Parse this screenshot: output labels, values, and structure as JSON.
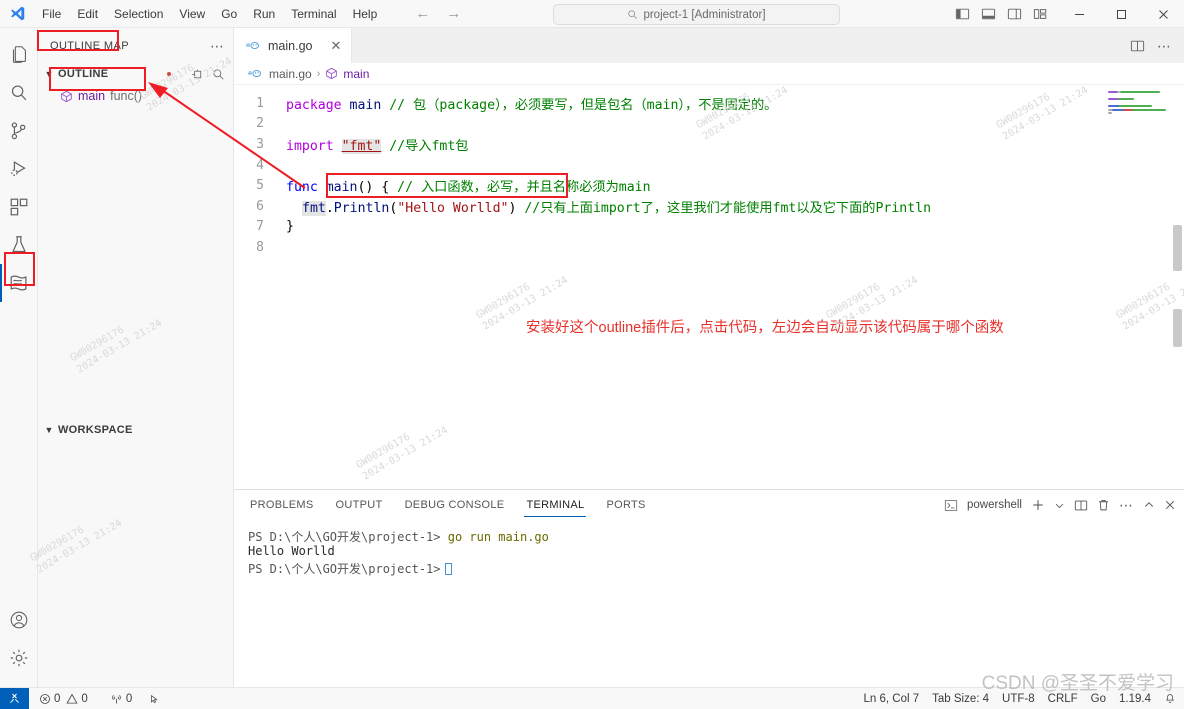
{
  "titlebar": {
    "menus": [
      "File",
      "Edit",
      "Selection",
      "View",
      "Go",
      "Run",
      "Terminal",
      "Help"
    ],
    "back_arrow": "←",
    "forward_arrow": "→",
    "search_placeholder": "project-1 [Administrator]",
    "layout_icons": [
      "toggle-primary-sidebar",
      "toggle-panel",
      "toggle-secondary-sidebar",
      "customize-layout"
    ],
    "window_controls": {
      "minimize": "─",
      "maximize": "□",
      "close": "✕"
    }
  },
  "activitybar": {
    "items": [
      {
        "name": "explorer",
        "label": "Explorer"
      },
      {
        "name": "search",
        "label": "Search"
      },
      {
        "name": "source-control",
        "label": "Source Control"
      },
      {
        "name": "run-and-debug",
        "label": "Run and Debug"
      },
      {
        "name": "extensions",
        "label": "Extensions"
      },
      {
        "name": "testing",
        "label": "Testing"
      },
      {
        "name": "outline-map",
        "label": "Outline Map"
      }
    ],
    "bottom_items": [
      {
        "name": "accounts",
        "label": "Accounts"
      },
      {
        "name": "manage",
        "label": "Manage"
      }
    ],
    "active_index": 6
  },
  "sidebar": {
    "title": "OUTLINE MAP",
    "more_actions": "⋯",
    "sections": [
      {
        "label": "OUTLINE",
        "expanded": true,
        "items": [
          {
            "icon": "class-symbol-icon",
            "name": "main",
            "kind": "func()"
          }
        ]
      },
      {
        "label": "WORKSPACE",
        "expanded": true,
        "items": []
      }
    ]
  },
  "editor": {
    "tab": {
      "label": "main.go",
      "icon": "go-file-icon",
      "close": "✕"
    },
    "tab_actions": [
      "split-editor",
      "more-actions"
    ],
    "breadcrumb": {
      "file": "main.go",
      "separator": "›",
      "symbol": "main"
    },
    "lines": [
      {
        "num": 1,
        "tokens": [
          {
            "t": "package ",
            "c": "kw2"
          },
          {
            "t": "main",
            "c": "fn"
          },
          {
            "t": " // 包（package），必须要写，但是包名（main），不是固定的。",
            "c": "cmt"
          }
        ]
      },
      {
        "num": 2,
        "tokens": []
      },
      {
        "num": 3,
        "tokens": [
          {
            "t": "import ",
            "c": "kw2"
          },
          {
            "t": "\"fmt\"",
            "c": "str hl underl"
          },
          {
            "t": " //导入fmt包",
            "c": "cmt"
          }
        ]
      },
      {
        "num": 4,
        "tokens": []
      },
      {
        "num": 5,
        "tokens": [
          {
            "t": "func ",
            "c": "kw"
          },
          {
            "t": "main",
            "c": "fn"
          },
          {
            "t": "() { ",
            "c": "ctext"
          },
          {
            "t": "// 入口函数，必写，并且名称必须为main",
            "c": "cmt"
          }
        ]
      },
      {
        "num": 6,
        "indent": true,
        "tokens": [
          {
            "t": "fmt",
            "c": "fn hl"
          },
          {
            "t": ".",
            "c": "ctext"
          },
          {
            "t": "Println",
            "c": "fn"
          },
          {
            "t": "(",
            "c": "ctext"
          },
          {
            "t": "\"Hello Worlld\"",
            "c": "str"
          },
          {
            "t": ")",
            "c": "ctext"
          },
          {
            "t": " //只有上面import了，这里我们才能使用fmt以及它下面的Println",
            "c": "cmt"
          }
        ]
      },
      {
        "num": 7,
        "tokens": [
          {
            "t": "}",
            "c": "ctext"
          }
        ]
      },
      {
        "num": 8,
        "tokens": []
      }
    ],
    "annotation": "安装好这个outline插件后，点击代码，左边会自动显示该代码属于哪个函数"
  },
  "panel": {
    "tabs": [
      "PROBLEMS",
      "OUTPUT",
      "DEBUG CONSOLE",
      "TERMINAL",
      "PORTS"
    ],
    "active_tab": "TERMINAL",
    "shell_name": "powershell",
    "actions": [
      "new-terminal",
      "terminal-dropdown",
      "split-terminal",
      "kill-terminal",
      "more-actions",
      "maximize-panel",
      "close-panel"
    ],
    "terminal_lines": [
      {
        "prompt": "PS D:\\个人\\GO开发\\project-1>",
        "command": " go run main.go"
      },
      {
        "prompt": "",
        "command": "Hello Worlld",
        "plain": true
      },
      {
        "prompt": "PS D:\\个人\\GO开发\\project-1>",
        "command": "",
        "cursor": true
      }
    ]
  },
  "statusbar": {
    "remote_icon": "remote-indicator-icon",
    "left": [
      {
        "name": "errors",
        "icon": "error-icon",
        "value": "0"
      },
      {
        "name": "warnings",
        "icon": "warning-icon",
        "value": "0"
      },
      {
        "name": "ports",
        "icon": "radio-tower-icon",
        "value": "0"
      },
      {
        "name": "go-build",
        "icon": "go-pointer-icon",
        "value": ""
      }
    ],
    "right": [
      "Ln 6, Col 7",
      "Tab Size: 4",
      "UTF-8",
      "CRLF",
      "Go",
      "1.19.4"
    ],
    "bell_icon": "bell-icon"
  },
  "watermarks": {
    "csdn": "CSDN @圣圣不爱学习",
    "tiled": "GW00296176\n2024-03-13 21:24"
  },
  "colors": {
    "accent": "#005fb8",
    "annotation_red": "#ee1c25",
    "keyword": "#0000ff",
    "keyword_alt": "#af00db",
    "string": "#a31515",
    "comment": "#008000",
    "function": "#001080",
    "symbol_purple": "#6a1fa5"
  }
}
